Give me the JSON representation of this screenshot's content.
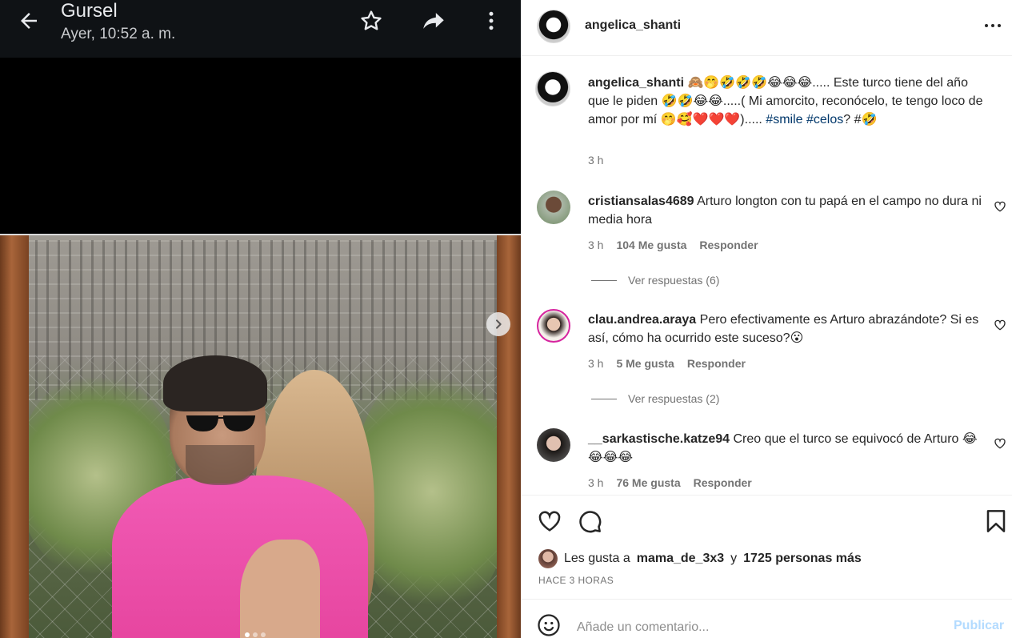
{
  "chat": {
    "title": "Gursel",
    "subtitle": "Ayer, 10:52 a. m."
  },
  "post": {
    "username": "angelica_shanti",
    "caption_user": "angelica_shanti",
    "caption_text_1": "🙈🤭🤣🤣🤣😂😂😂..... Este turco tiene del año que le piden 🤣🤣😂😂.....( Mi amorcito, reconócelo, te tengo loco de amor por mí 🤭🥰❤️❤️❤️)..... ",
    "hashtag_smile": "#smile",
    "hashtag_celos": "#celos",
    "caption_text_2": "? #🤣",
    "caption_time": "3 h"
  },
  "comments": [
    {
      "user": "cristiansalas4689",
      "text": "Arturo longton con tu papá en el campo no dura ni media hora",
      "time": "3 h",
      "likes": "104 Me gusta",
      "reply": "Responder",
      "view_replies": "Ver respuestas (6)"
    },
    {
      "user": "clau.andrea.araya",
      "text": "Pero efectivamente es Arturo abrazándote? Si es así, cómo ha ocurrido este suceso?😮",
      "time": "3 h",
      "likes": "5 Me gusta",
      "reply": "Responder",
      "view_replies": "Ver respuestas (2)"
    },
    {
      "user": "__sarkastische.katze94",
      "text": "Creo que el turco se equivocó de Arturo 😂😂😂😂",
      "time": "3 h",
      "likes": "76 Me gusta",
      "reply": "Responder"
    }
  ],
  "likes": {
    "prefix": "Les gusta a",
    "user": "mama_de_3x3",
    "connector": "y",
    "others": "1725 personas más",
    "time_ago": "HACE 3 HORAS"
  },
  "composer": {
    "placeholder": "Añade un comentario...",
    "publish": "Publicar"
  },
  "colors": {
    "link": "#00376b",
    "muted": "#737373",
    "publish_disabled": "#b3dbff",
    "chat_bar": "#0f1215"
  },
  "icons": [
    "arrow-back-icon",
    "star-icon",
    "share-icon",
    "more-vertical-icon",
    "chevron-right-icon",
    "more-horizontal-icon",
    "heart-icon",
    "comment-icon",
    "bookmark-icon",
    "emoji-icon"
  ]
}
